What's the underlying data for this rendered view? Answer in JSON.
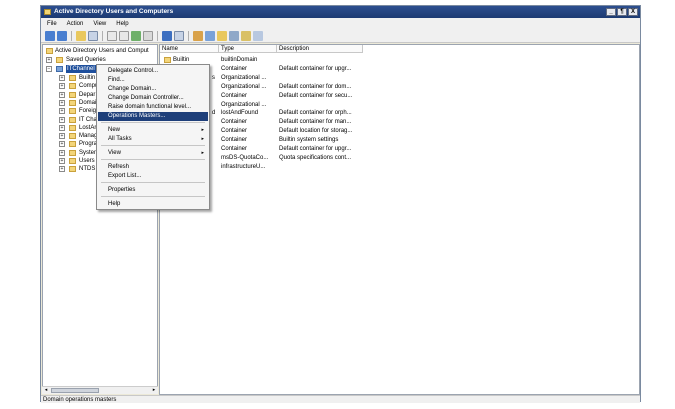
{
  "window": {
    "title": "Active Directory Users and Computers",
    "buttons": [
      "_",
      "¶",
      "X"
    ]
  },
  "menubar": [
    "File",
    "Action",
    "View",
    "Help"
  ],
  "toolbar_icons": [
    "back-icon",
    "forward-icon",
    "up-folder-icon",
    "show-hide-tree-icon",
    "delete-icon",
    "properties-icon",
    "refresh-icon",
    "export-icon",
    "help-icon",
    "console-icon",
    "new-user-icon",
    "new-group-icon",
    "new-ou-icon",
    "filter-icon",
    "add-to-group-icon",
    "find-icon"
  ],
  "tree": {
    "root": "Active Directory Users and Comput",
    "saved_queries": "Saved Queries",
    "domain": "ITChannel",
    "children": [
      "Builtin",
      "Compu",
      "Depar",
      "Domai",
      "Foreig",
      "IT Cha",
      "LostAr",
      "Manag",
      "Progra",
      "Systen",
      "Users",
      "NTDS"
    ]
  },
  "list": {
    "columns": [
      "Name",
      "Type",
      "Description"
    ],
    "rows": [
      {
        "name": "Builtin",
        "type": "builtinDomain",
        "description": ""
      },
      {
        "name": "",
        "type": "Container",
        "description": "Default container for upgr..."
      },
      {
        "name": "s",
        "type": "Organizational ...",
        "description": ""
      },
      {
        "name": "",
        "type": "Organizational ...",
        "description": "Default container for dom..."
      },
      {
        "name": "",
        "type": "Container",
        "description": "Default container for secu..."
      },
      {
        "name": "",
        "type": "Organizational ...",
        "description": ""
      },
      {
        "name": "d",
        "type": "lostAndFound",
        "description": "Default container for orph..."
      },
      {
        "name": "",
        "type": "Container",
        "description": "Default container for man..."
      },
      {
        "name": "",
        "type": "Container",
        "description": "Default location for storag..."
      },
      {
        "name": "",
        "type": "Container",
        "description": "Builtin system settings"
      },
      {
        "name": "",
        "type": "Container",
        "description": "Default container for upgr..."
      },
      {
        "name": "",
        "type": "msDS-QuotaCo...",
        "description": "Quota specifications cont..."
      },
      {
        "name": "",
        "type": "infrastructureU...",
        "description": ""
      }
    ]
  },
  "context_menu": {
    "items": [
      "Delegate Control...",
      "Find...",
      "Change Domain...",
      "Change Domain Controller...",
      "Raise domain functional level...",
      "Operations Masters...",
      "New",
      "All Tasks",
      "View",
      "Refresh",
      "Export List...",
      "Properties",
      "Help"
    ],
    "highlighted": "Operations Masters...",
    "submenu_marker": "▸"
  },
  "status": "Domain operations masters",
  "colors": {
    "titlebar": "#1c3a72",
    "selection": "#1e3f7a",
    "folder": "#f3d57a"
  }
}
